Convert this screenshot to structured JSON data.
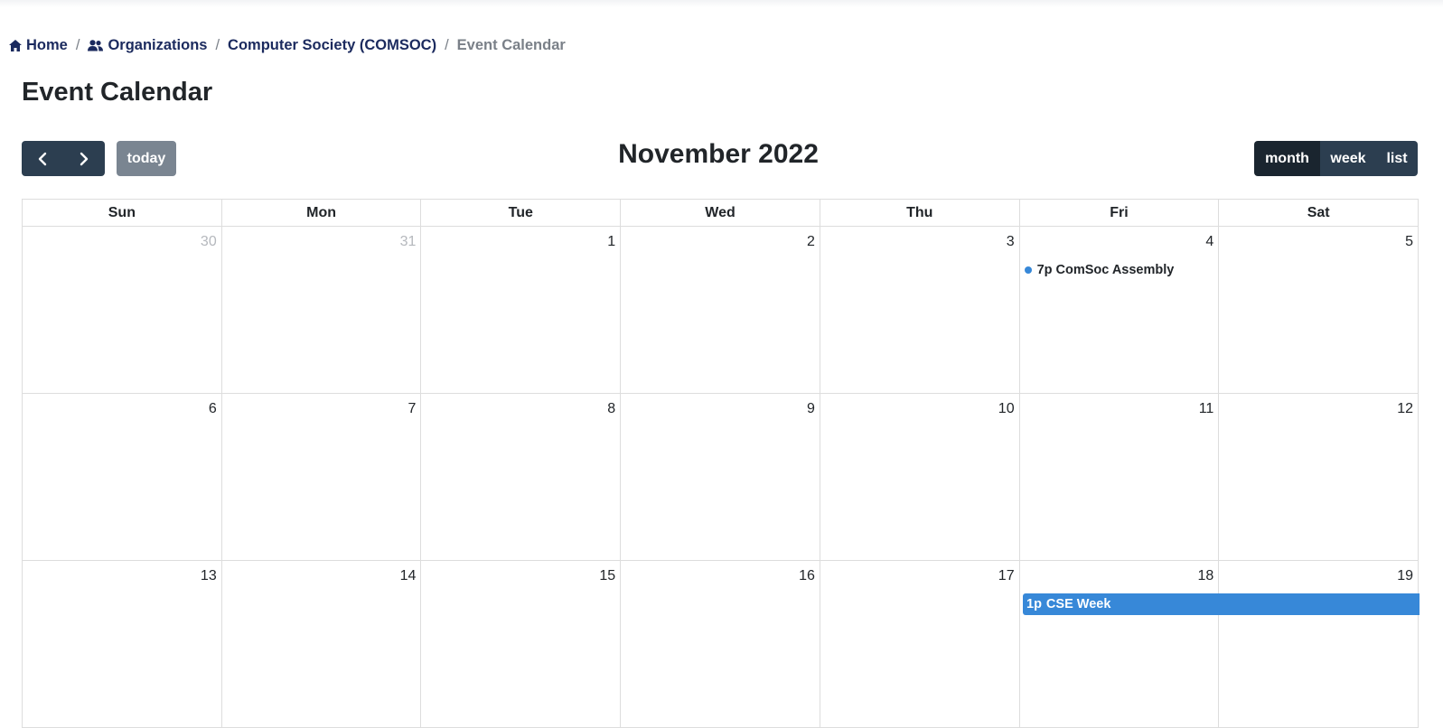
{
  "breadcrumb": {
    "items": [
      {
        "label": "Home",
        "icon": "home-icon"
      },
      {
        "label": "Organizations",
        "icon": "users-icon"
      },
      {
        "label": "Computer Society (COMSOC)"
      },
      {
        "label": "Event Calendar"
      }
    ],
    "separator": "/"
  },
  "page": {
    "title": "Event Calendar"
  },
  "toolbar": {
    "prev_icon": "chevron-left-icon",
    "next_icon": "chevron-right-icon",
    "today_label": "today",
    "title": "November 2022",
    "views": [
      {
        "label": "month",
        "active": true
      },
      {
        "label": "week",
        "active": false
      },
      {
        "label": "list",
        "active": false
      }
    ]
  },
  "calendar": {
    "days_of_week": [
      "Sun",
      "Mon",
      "Tue",
      "Wed",
      "Thu",
      "Fri",
      "Sat"
    ],
    "weeks": [
      {
        "days": [
          "30",
          "31",
          "1",
          "2",
          "3",
          "4",
          "5"
        ],
        "other_month": [
          true,
          true,
          false,
          false,
          false,
          false,
          false
        ]
      },
      {
        "days": [
          "6",
          "7",
          "8",
          "9",
          "10",
          "11",
          "12"
        ],
        "other_month": [
          false,
          false,
          false,
          false,
          false,
          false,
          false
        ]
      },
      {
        "days": [
          "13",
          "14",
          "15",
          "16",
          "17",
          "18",
          "19"
        ],
        "other_month": [
          false,
          false,
          false,
          false,
          false,
          false,
          false
        ]
      }
    ],
    "events": [
      {
        "time": "7p",
        "title": "ComSoc Assembly",
        "day": "4",
        "style": "dot"
      },
      {
        "time": "1p",
        "title": "CSE Week",
        "start_day": "18",
        "end_day": "19",
        "style": "block"
      }
    ],
    "colors": {
      "event": "#3788d8",
      "button": "#2c3e50",
      "button_active": "#1a252f",
      "border": "#dddddd"
    }
  }
}
